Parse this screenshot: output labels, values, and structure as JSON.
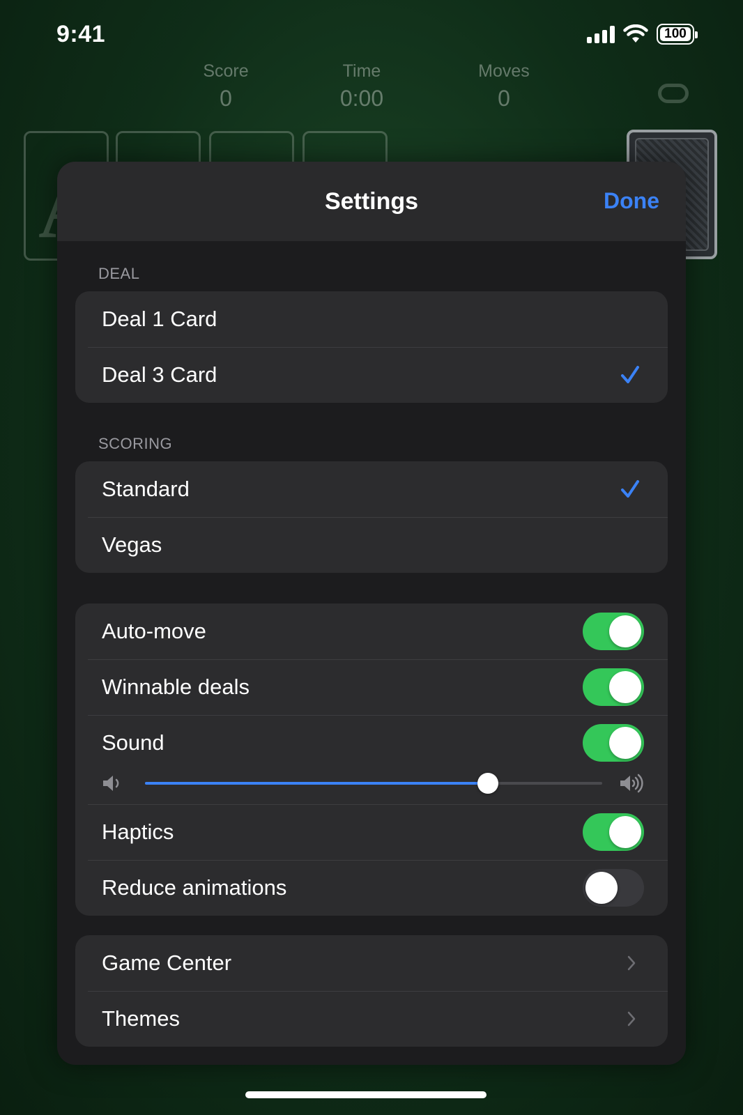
{
  "status_bar": {
    "time": "9:41",
    "battery": "100"
  },
  "game": {
    "stats": [
      {
        "label": "Score",
        "value": "0"
      },
      {
        "label": "Time",
        "value": "0:00"
      },
      {
        "label": "Moves",
        "value": "0"
      }
    ],
    "foundation_glyph": "A"
  },
  "settings": {
    "title": "Settings",
    "done_label": "Done",
    "deal": {
      "header": "DEAL",
      "options": [
        "Deal 1 Card",
        "Deal 3 Card"
      ],
      "selected": "Deal 3 Card"
    },
    "scoring": {
      "header": "SCORING",
      "options": [
        "Standard",
        "Vegas"
      ],
      "selected": "Standard"
    },
    "toggles": {
      "auto_move": {
        "label": "Auto-move",
        "on": true
      },
      "winnable_deals": {
        "label": "Winnable deals",
        "on": true
      },
      "sound": {
        "label": "Sound",
        "on": true,
        "volume": 0.75
      },
      "haptics": {
        "label": "Haptics",
        "on": true
      },
      "reduce_animations": {
        "label": "Reduce animations",
        "on": false
      }
    },
    "links": {
      "game_center": "Game Center",
      "themes": "Themes"
    }
  },
  "colors": {
    "accent": "#3b82f6",
    "toggle_on": "#34c759",
    "felt": "#1f4a2a"
  }
}
